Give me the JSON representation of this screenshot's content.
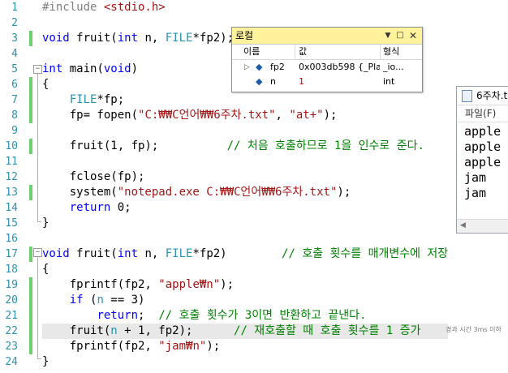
{
  "editor": {
    "line_numbers": [
      "1",
      "2",
      "3",
      "4",
      "5",
      "6",
      "7",
      "8",
      "9",
      "10",
      "11",
      "12",
      "13",
      "14",
      "15",
      "16",
      "17",
      "18",
      "19",
      "20",
      "21",
      "22",
      "23",
      "24"
    ],
    "l1_pp": "#include ",
    "l1_inc": "<stdio.h>",
    "l3_a": "void",
    "l3_b": " fruit(",
    "l3_c": "int",
    "l3_d": " n, ",
    "l3_e": "FILE",
    "l3_f": "*fp2);",
    "l5_a": "int",
    "l5_b": " main(",
    "l5_c": "void",
    "l5_d": ")",
    "l6": "{",
    "l7_a": "    ",
    "l7_b": "FILE",
    "l7_c": "*fp;",
    "l8_a": "    fp= fopen(",
    "l8_b": "\"C:₩₩C언어₩₩6주차.txt\"",
    "l8_c": ", ",
    "l8_d": "\"at+\"",
    "l8_e": ");",
    "l10_a": "    fruit(1, fp);",
    "l10_b": "          // 처음 호출하므로 1을 인수로 준다.",
    "l12": "    fclose(fp);",
    "l13_a": "    system(",
    "l13_b": "\"notepad.exe C:₩₩C언어₩₩6주차.txt\"",
    "l13_c": ");",
    "l14_a": "    ",
    "l14_b": "return",
    "l14_c": " 0;",
    "l15": "}",
    "l17_a": "void",
    "l17_b": " fruit(",
    "l17_c": "int",
    "l17_d": " n, ",
    "l17_e": "FILE",
    "l17_f": "*fp2)",
    "l17_g": "        // 호출 횟수를 매개변수에 저장",
    "l18": "{",
    "l19_a": "    fprintf(fp2, ",
    "l19_b": "\"apple₩n\"",
    "l19_c": ");",
    "l20_a": "    ",
    "l20_b": "if",
    "l20_c": " (",
    "l20_d": "n",
    "l20_e": " == 3)",
    "l21_a": "        ",
    "l21_b": "return",
    "l21_c": ";  ",
    "l21_d": "// 호출 횟수가 3이면 반환하고 끝낸다.",
    "l22_a": "    fruit(",
    "l22_b": "n",
    "l22_c": " + 1, fp2);",
    "l22_d": "      // 재호출할 때 호출 횟수를 1 증가",
    "l23_a": "    fprintf(fp2, ",
    "l23_b": "\"jam₩n\"",
    "l23_c": ");",
    "l24": "}",
    "tooltip": "경과 시간 3ms 이하"
  },
  "watch": {
    "title": "로컬",
    "pin_icon": "pin-icon",
    "menu_icon": "dropdown-icon",
    "maximize_icon": "maximize-icon",
    "close_icon": "close-icon",
    "col_name": "이름",
    "col_value": "값",
    "col_type": "형식",
    "rows": [
      {
        "name": "fp2",
        "value": "0x003db598 {_Pla...",
        "type": "_io...",
        "expand": "▷"
      },
      {
        "name": "n",
        "value": "1",
        "type": "int",
        "expand": ""
      }
    ]
  },
  "notepad": {
    "title": "6주차.t",
    "menu_file": "파일(F)",
    "lines": [
      "apple",
      "apple",
      "apple",
      "jam",
      "jam"
    ]
  },
  "colors": {
    "keyword": "#0000ff",
    "string": "#a31515",
    "comment": "#008000",
    "type": "#2b91af",
    "title_bar": "#fff29d",
    "change_mark": "#6ecf6e"
  }
}
